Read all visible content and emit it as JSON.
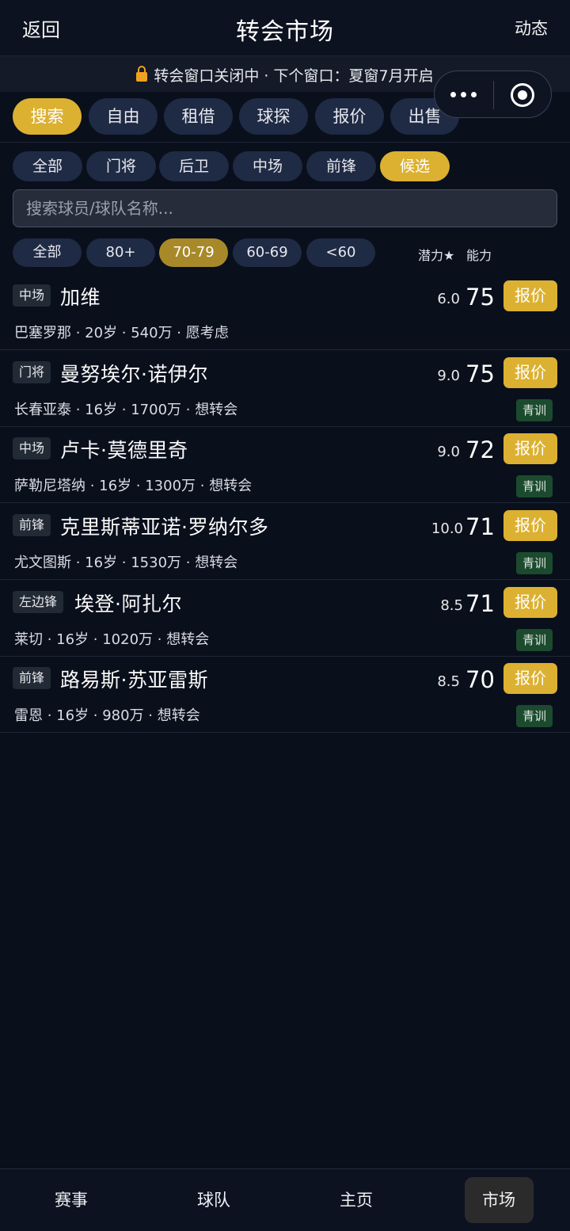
{
  "header": {
    "back_label": "返回",
    "title": "转会市场",
    "news_label": "动态"
  },
  "notice": {
    "text": "转会窗口关闭中 · 下个窗口：夏窗7月开启"
  },
  "tabs": [
    "搜索",
    "自由",
    "租借",
    "球探",
    "报价",
    "出售"
  ],
  "position_filters": [
    "全部",
    "门将",
    "后卫",
    "中场",
    "前锋",
    "候选"
  ],
  "search": {
    "placeholder": "搜索球员/球队名称..."
  },
  "rating_filters": [
    "全部",
    "80+",
    "70-79",
    "60-69",
    "<60"
  ],
  "legend": {
    "potential": "潜力★",
    "ability": "能力"
  },
  "players": [
    {
      "position": "中场",
      "name": "加维",
      "details": "巴塞罗那 · 20岁 · 540万 · 愿考虑",
      "potential": "6.0",
      "ability": "75",
      "offer_label": "报价",
      "badge": ""
    },
    {
      "position": "门将",
      "name": "曼努埃尔·诺伊尔",
      "details": "长春亚泰 · 16岁 · 1700万 · 想转会",
      "potential": "9.0",
      "ability": "75",
      "offer_label": "报价",
      "badge": "青训"
    },
    {
      "position": "中场",
      "name": "卢卡·莫德里奇",
      "details": "萨勒尼塔纳 · 16岁 · 1300万 · 想转会",
      "potential": "9.0",
      "ability": "72",
      "offer_label": "报价",
      "badge": "青训"
    },
    {
      "position": "前锋",
      "name": "克里斯蒂亚诺·罗纳尔多",
      "details": "尤文图斯 · 16岁 · 1530万 · 想转会",
      "potential": "10.0",
      "ability": "71",
      "offer_label": "报价",
      "badge": "青训"
    },
    {
      "position": "左边锋",
      "name": "埃登·阿扎尔",
      "details": "莱切 · 16岁 · 1020万 · 想转会",
      "potential": "8.5",
      "ability": "71",
      "offer_label": "报价",
      "badge": "青训"
    },
    {
      "position": "前锋",
      "name": "路易斯·苏亚雷斯",
      "details": "雷恩 · 16岁 · 980万 · 想转会",
      "potential": "8.5",
      "ability": "70",
      "offer_label": "报价",
      "badge": "青训"
    }
  ],
  "bottom_nav": [
    "赛事",
    "球队",
    "主页",
    "市场"
  ],
  "colors": {
    "accent": "#dcb131",
    "background": "#0a0f1c",
    "pill": "#1f2a44",
    "youth_badge": "#1c4a2e"
  }
}
